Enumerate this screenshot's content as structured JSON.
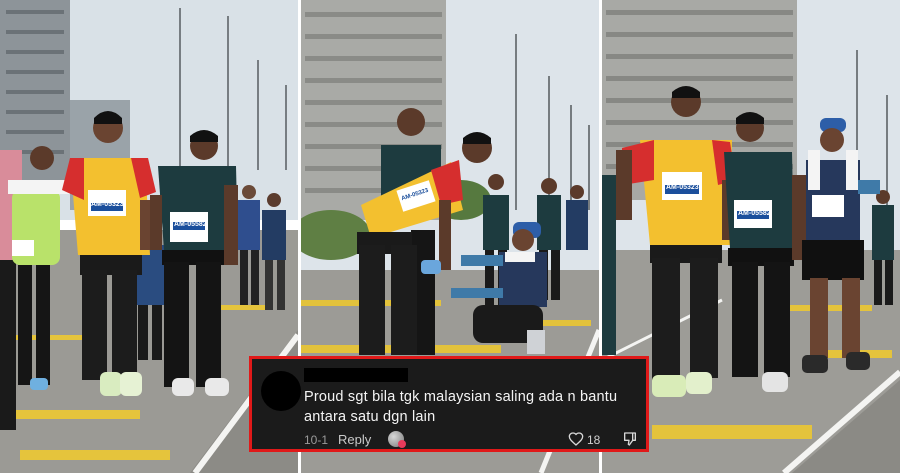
{
  "comment": {
    "text": "Proud sgt bila tgk malaysian saling ada n bantu antara satu dgn lain",
    "date": "10-1",
    "reply_label": "Reply",
    "like_count": "18"
  },
  "bibs": {
    "panel1_left": "AM-05323",
    "panel1_right": "AM-05582",
    "panel2_helper": "AM-05323",
    "panel3_left": "AM-05323",
    "panel3_middle": "AM-05582"
  },
  "colors": {
    "comment_border": "#e01919",
    "comment_bg": "#1b1b1b",
    "yellow_shirt": "#f3c02f",
    "dark_shirt": "#1d3b3f"
  }
}
